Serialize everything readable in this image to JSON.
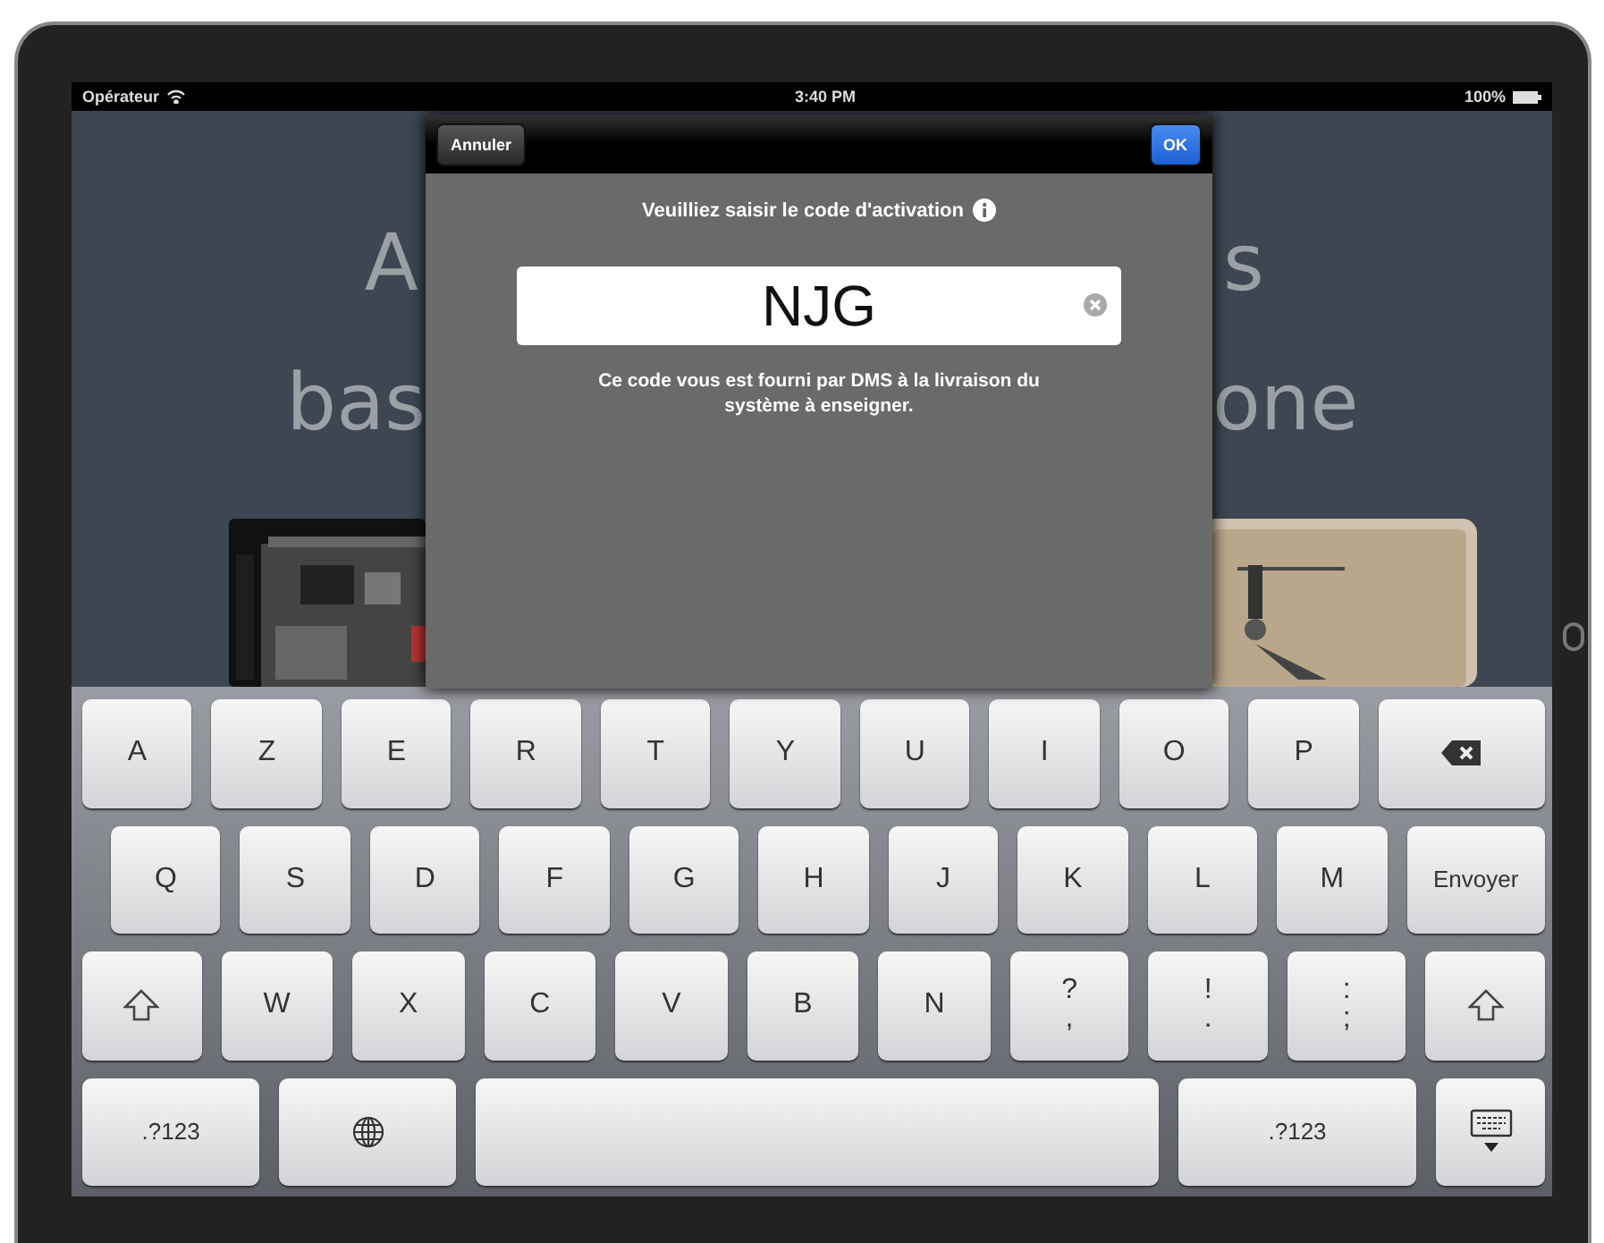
{
  "status_bar": {
    "carrier": "Opérateur",
    "time": "3:40 PM",
    "battery": "100%"
  },
  "background": {
    "lines": [
      {
        "left": "A",
        "right": "s"
      },
      {
        "left": "bas",
        "right": "one"
      }
    ]
  },
  "dialog": {
    "cancel": "Annuler",
    "ok": "OK",
    "prompt": "Veuilliez saisir le code d'activation",
    "value": "NJG",
    "help": "Ce code vous est fourni par DMS à la livraison du système à enseigner."
  },
  "keyboard": {
    "rows": [
      {
        "indent": false,
        "keys": [
          {
            "kind": "char",
            "label": "A"
          },
          {
            "kind": "char",
            "label": "Z"
          },
          {
            "kind": "char",
            "label": "E"
          },
          {
            "kind": "char",
            "label": "R"
          },
          {
            "kind": "char",
            "label": "T"
          },
          {
            "kind": "char",
            "label": "Y"
          },
          {
            "kind": "char",
            "label": "U"
          },
          {
            "kind": "char",
            "label": "I"
          },
          {
            "kind": "char",
            "label": "O"
          },
          {
            "kind": "char",
            "label": "P"
          },
          {
            "kind": "backspace"
          }
        ]
      },
      {
        "indent": true,
        "keys": [
          {
            "kind": "char",
            "label": "Q"
          },
          {
            "kind": "char",
            "label": "S"
          },
          {
            "kind": "char",
            "label": "D"
          },
          {
            "kind": "char",
            "label": "F"
          },
          {
            "kind": "char",
            "label": "G"
          },
          {
            "kind": "char",
            "label": "H"
          },
          {
            "kind": "char",
            "label": "J"
          },
          {
            "kind": "char",
            "label": "K"
          },
          {
            "kind": "char",
            "label": "L"
          },
          {
            "kind": "char",
            "label": "M"
          },
          {
            "kind": "return",
            "label": "Envoyer"
          }
        ]
      },
      {
        "indent": false,
        "keys": [
          {
            "kind": "shift"
          },
          {
            "kind": "char",
            "label": "W"
          },
          {
            "kind": "char",
            "label": "X"
          },
          {
            "kind": "char",
            "label": "C"
          },
          {
            "kind": "char",
            "label": "V"
          },
          {
            "kind": "char",
            "label": "B"
          },
          {
            "kind": "char",
            "label": "N"
          },
          {
            "kind": "dual",
            "top": "?",
            "bottom": ","
          },
          {
            "kind": "dual",
            "top": "!",
            "bottom": "."
          },
          {
            "kind": "dual",
            "top": ":",
            "bottom": ";"
          },
          {
            "kind": "shift"
          }
        ]
      },
      {
        "indent": false,
        "keys": [
          {
            "kind": "numbers",
            "label": ".?123"
          },
          {
            "kind": "globe"
          },
          {
            "kind": "space"
          },
          {
            "kind": "numbers_wide",
            "label": ".?123"
          },
          {
            "kind": "hide"
          }
        ]
      }
    ]
  }
}
